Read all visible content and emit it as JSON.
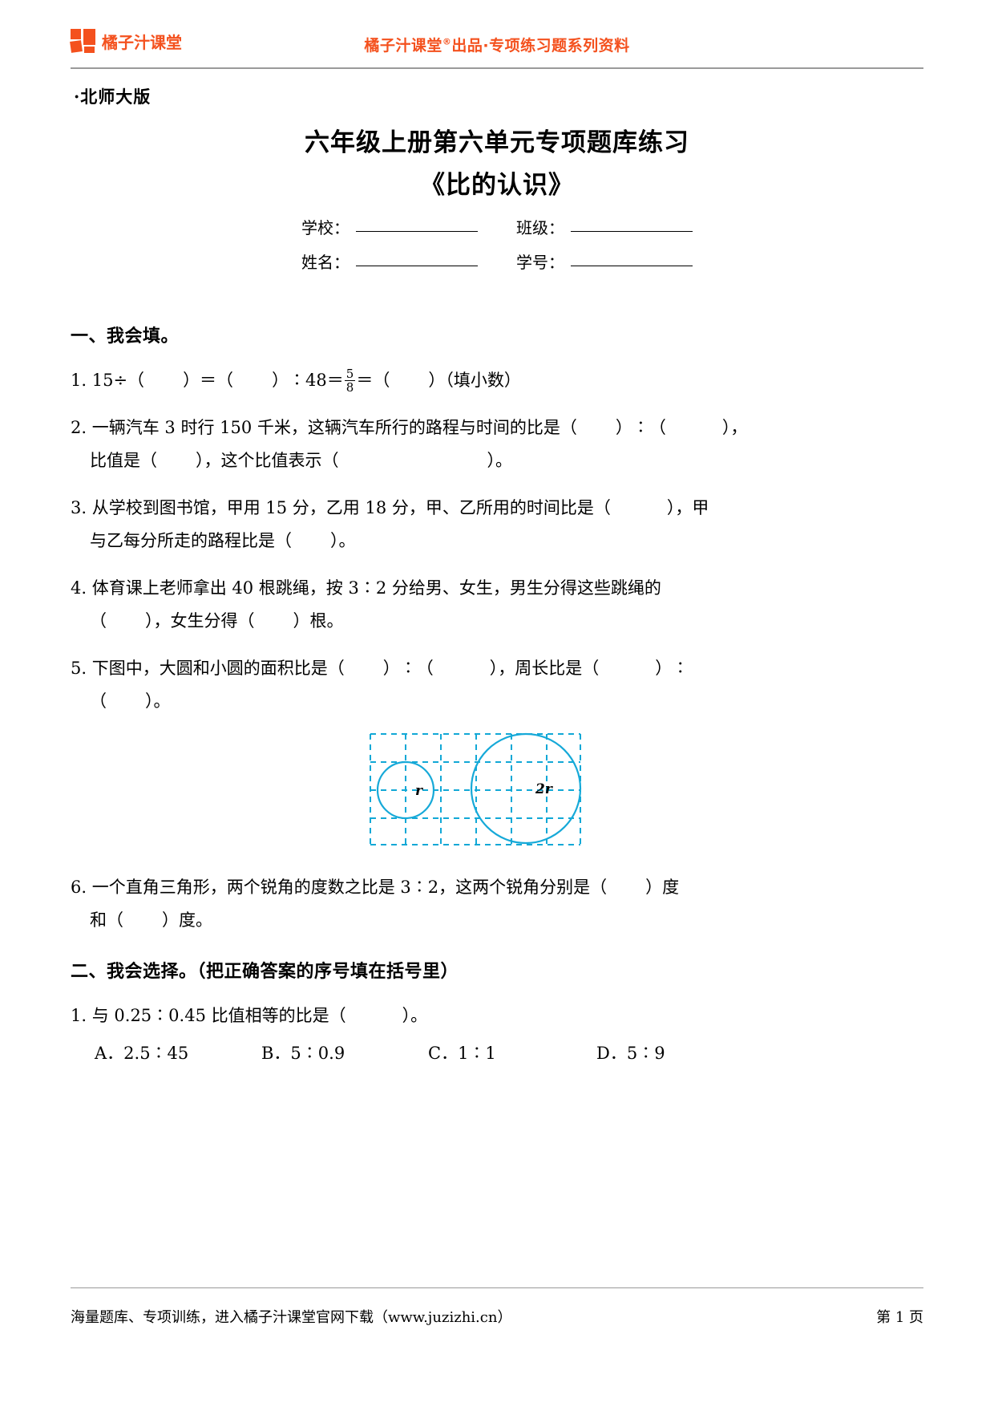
{
  "header": {
    "logo_text": "橘子汁课堂",
    "slogan_prefix": "橘子汁课堂",
    "slogan_mark": "®",
    "slogan_suffix": "出品·专项练习题系列资料",
    "brand_color": "#F4511E"
  },
  "title_block": {
    "edition": "·北师大版",
    "title": "六年级上册第六单元专项题库练习",
    "subtitle": "《比的认识》"
  },
  "info_fields": {
    "school_label": "学校：",
    "school_value": "",
    "class_label": "班级：",
    "class_value": "",
    "name_label": "姓名：",
    "name_value": "",
    "student_id_label": "学号：",
    "student_id_value": ""
  },
  "section_one": {
    "heading": "一、我会填。",
    "q1": {
      "num": "1.",
      "p1": "15÷（",
      "p2": "）＝（",
      "p3": "）∶48＝",
      "frac_num": "5",
      "frac_den": "8",
      "p4": "＝（",
      "p5": "）（填小数）"
    },
    "q2": {
      "num": "2.",
      "line1_a": "一辆汽车 3 时行 150 千米，这辆汽车所行的路程与时间的比是（",
      "line1_b": "）∶（",
      "line1_c": "），",
      "line2_a": "比值是（",
      "line2_b": "），这个比值表示（",
      "line2_c": "）。"
    },
    "q3": {
      "num": "3.",
      "line1_a": "从学校到图书馆，甲用 15 分，乙用 18 分，甲、乙所用的时间比是（",
      "line1_b": "），甲",
      "line2_a": "与乙每分所走的路程比是（",
      "line2_b": "）。"
    },
    "q4": {
      "num": "4.",
      "line1": "体育课上老师拿出 40 根跳绳，按 3∶2 分给男、女生，男生分得这些跳绳的",
      "line2_a": "（",
      "line2_b": "），女生分得（",
      "line2_c": "）根。"
    },
    "q5": {
      "num": "5.",
      "line1_a": "下图中，大圆和小圆的面积比是（",
      "line1_b": "）∶（",
      "line1_c": "），周长比是（",
      "line1_d": "）∶",
      "line2_a": "（",
      "line2_b": "）。"
    },
    "figure": {
      "small_circle_label": "r",
      "large_circle_label": "2r",
      "grid_color": "#12A8D6",
      "circle_color": "#16A9D8"
    },
    "q6": {
      "num": "6.",
      "line1_a": "一个直角三角形，两个锐角的度数之比是 3∶2，这两个锐角分别是（",
      "line1_b": "）度",
      "line2_a": "和（",
      "line2_b": "）度。"
    }
  },
  "section_two": {
    "heading": "二、我会选择。（把正确答案的序号填在括号里）",
    "q1": {
      "num": "1.",
      "text_a": "与 0.25∶0.45 比值相等的比是（",
      "text_b": "）。",
      "options": [
        "A．2.5∶45",
        "B．5∶0.9",
        "C．1∶1",
        "D．5∶9"
      ]
    }
  },
  "footer": {
    "note": "海量题库、专项训练，进入橘子汁课堂官网下载（www.juzizhi.cn）",
    "page": "第 1 页"
  }
}
